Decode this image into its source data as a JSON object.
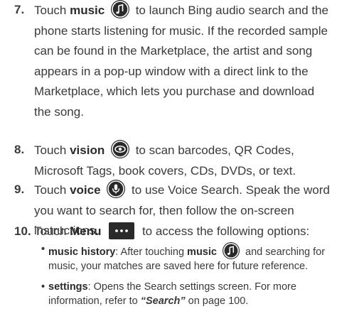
{
  "steps": [
    {
      "number": "7.",
      "pre": "Touch ",
      "keyword": "music",
      "icon": "music-note-icon",
      "post": " to launch Bing audio search and the phone starts listening for music. If the recorded sample can be found in the Marketplace, the artist and song appears in a pop-up window with a direct link to the Marketplace, which lets you purchase and download the song."
    },
    {
      "number": "8.",
      "pre": "Touch ",
      "keyword": "vision",
      "icon": "eye-icon",
      "post": " to scan barcodes, QR Codes, Microsoft Tags, book covers, CDs, DVDs, or text."
    },
    {
      "number": "9.",
      "pre": "Touch ",
      "keyword": "voice",
      "icon": "microphone-icon",
      "post": " to use Voice Search. Speak the word you want to search for, then follow the on-screen instructions."
    },
    {
      "number": "10.",
      "pre": "Touch ",
      "keyword": "Menu",
      "icon": "ellipsis-icon",
      "post": " to access the following options:"
    }
  ],
  "bullets": [
    {
      "dot": "•",
      "term": "music history",
      "pre": ": After touching ",
      "keyword": "music",
      "icon": "music-note-icon",
      "post": " and searching for music, your matches are saved here for future reference."
    },
    {
      "dot": "•",
      "term": "settings",
      "pre": ": Opens the Search settings screen. For more information, refer to ",
      "ref": "“Search”",
      "post": " on page 100."
    }
  ],
  "colors": {
    "text": "#3a3a3a",
    "icon_bg": "#2a2a2a",
    "icon_fg": "#ffffff"
  }
}
